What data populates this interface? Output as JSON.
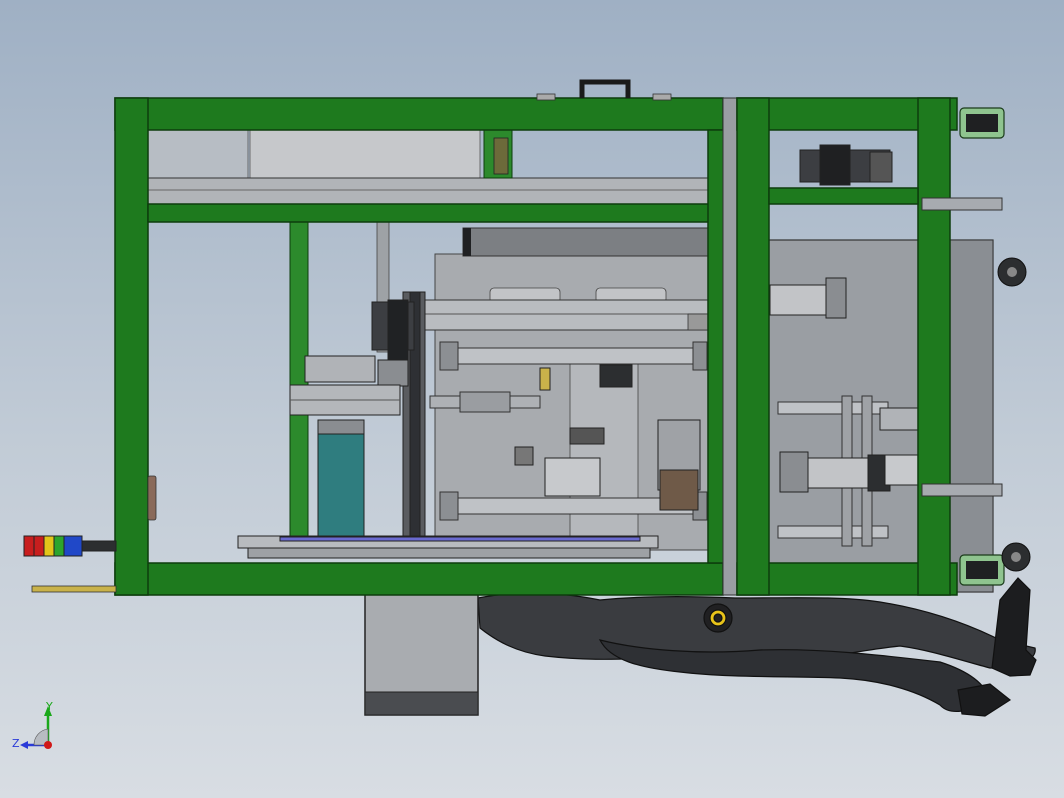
{
  "triad": {
    "y_label": "Y",
    "z_label": "Z",
    "y_color": "#1aa81a",
    "z_color": "#2a3ad8",
    "x_color": "#d01818"
  },
  "colors": {
    "frame_green": "#1e7a1e",
    "frame_edge": "#0d3d0d",
    "panel_gray": "#8e9297",
    "dark": "#2c2e30",
    "steel": "#c9ccd0"
  }
}
